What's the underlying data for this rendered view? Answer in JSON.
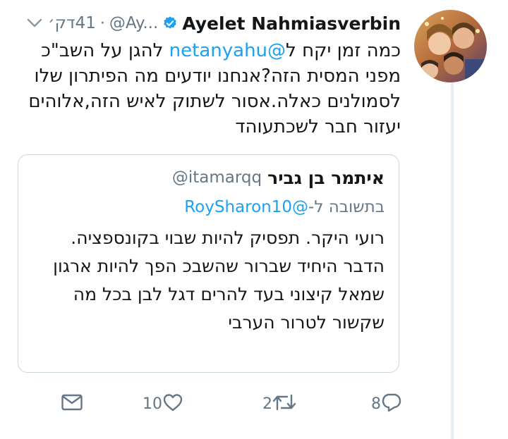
{
  "tweet": {
    "author_name": "Ayelet Nahmiasverbin",
    "handle": "@Ay...",
    "separator": "·",
    "time": "41דק׳",
    "text_before_mention": "כמה זמן יקח ל",
    "mention": "@netanyahu",
    "text_after_mention": " להגן על השב\"כ מפני המסית הזה?אנחנו יודעים מה הפיתרון שלו לסמולנים כאלה.אסור לשתוק לאיש הזה,אלוהים יעזור חבר לשכתעוהד"
  },
  "quoted": {
    "author_name": "איתמר בן גביר",
    "handle": "@itamarqq",
    "reply_prefix": "בתשובה ל-",
    "reply_handle": "@RoySharon10",
    "text": "רועי היקר. תפסיק להיות שבוי בקונספציה. הדבר היחיד שברור שהשבכ הפך להיות ארגון שמאל קיצוני בעד להרים דגל לבן בכל מה שקשור לטרור הערבי"
  },
  "actions": {
    "reply_count": "8",
    "retweet_count": "2",
    "like_count": "10"
  },
  "colors": {
    "accent": "#1da1f2",
    "muted": "#657786",
    "border": "#ccd6dd"
  },
  "icons": [
    "chevron-down-icon",
    "verified-badge-icon",
    "reply-icon",
    "retweet-icon",
    "like-icon",
    "direct-message-icon"
  ]
}
